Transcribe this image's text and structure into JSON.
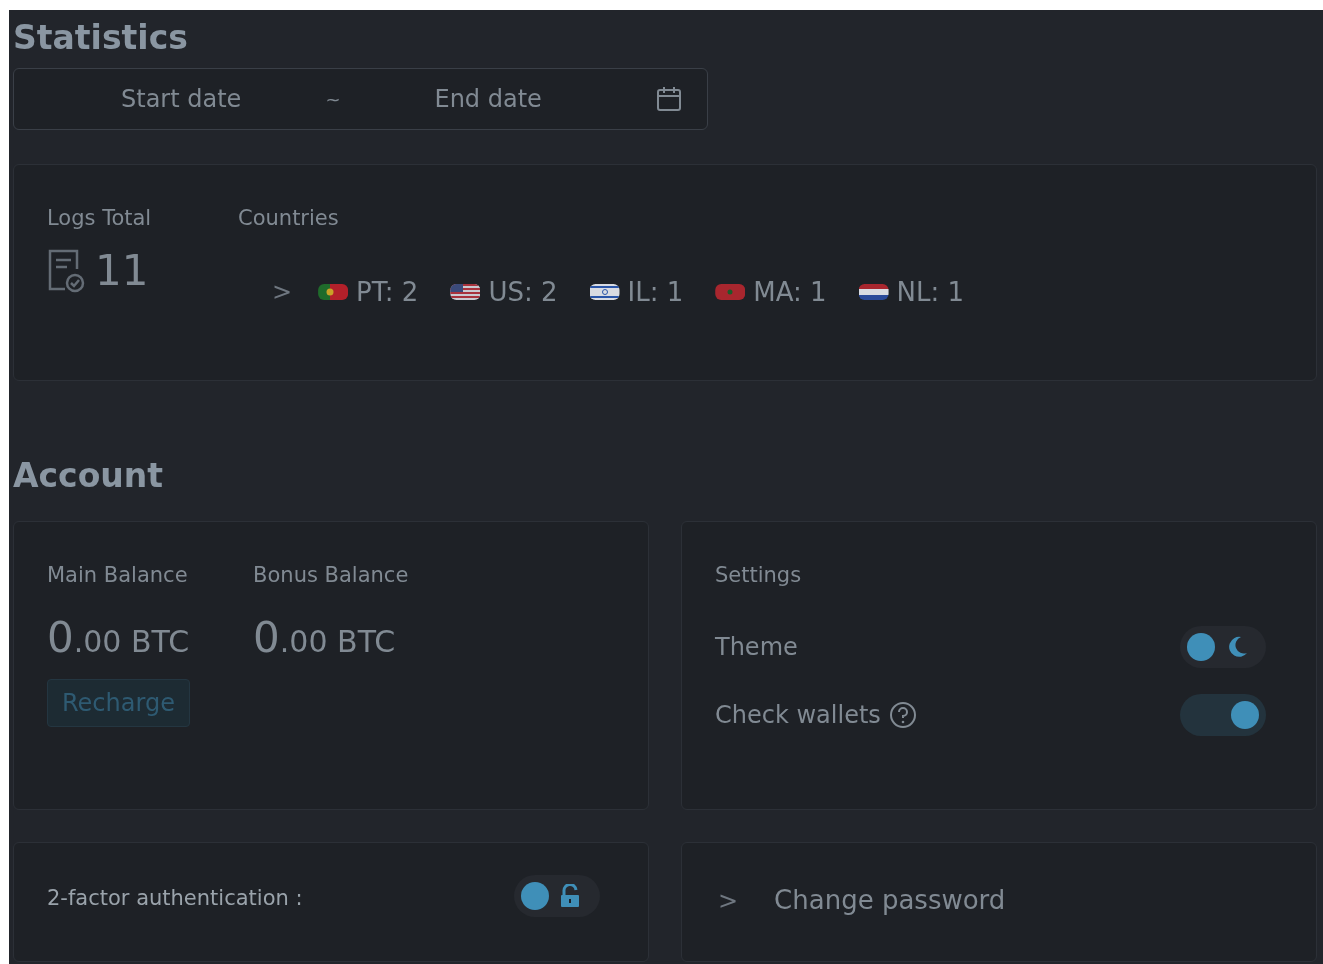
{
  "statistics": {
    "title": "Statistics",
    "date_range": {
      "start_placeholder": "Start date",
      "separator": "~",
      "end_placeholder": "End date"
    },
    "logs_total": {
      "label": "Logs Total",
      "value": "11"
    },
    "countries": {
      "label": "Countries",
      "expander": ">",
      "items": [
        {
          "kind": "pt",
          "text": "PT: 2"
        },
        {
          "kind": "us",
          "text": "US: 2"
        },
        {
          "kind": "il",
          "text": "IL: 1"
        },
        {
          "kind": "ma",
          "text": "MA: 1"
        },
        {
          "kind": "nl",
          "text": "NL: 1"
        }
      ]
    }
  },
  "account": {
    "title": "Account",
    "balances": [
      {
        "label": "Main Balance",
        "integer": "0",
        "rest": ".00 BTC"
      },
      {
        "label": "Bonus Balance",
        "integer": "0",
        "rest": ".00 BTC"
      }
    ],
    "recharge_button": "Recharge",
    "settings": {
      "title": "Settings",
      "rows": [
        {
          "label": "Theme",
          "kind": "theme",
          "on": false
        },
        {
          "label": "Check wallets",
          "kind": "help",
          "on": true
        }
      ]
    },
    "two_factor": {
      "label": "2-factor authentication :",
      "on": false
    },
    "change_password": {
      "expander": ">",
      "label": "Change password"
    }
  }
}
